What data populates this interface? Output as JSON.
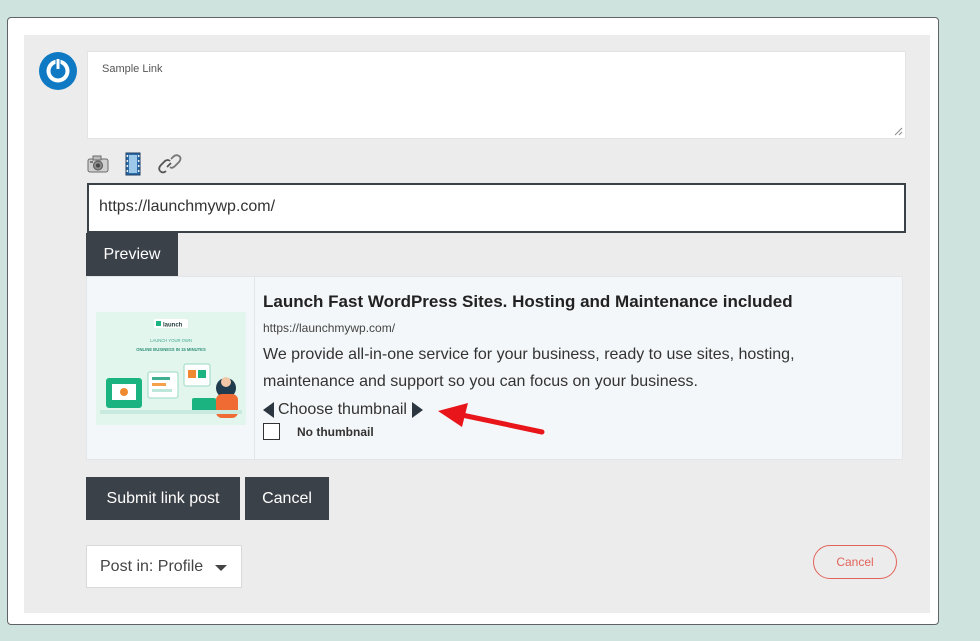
{
  "composer": {
    "placeholder": "Sample Link"
  },
  "attachments": {
    "icons": [
      "camera-icon",
      "film-icon",
      "link-icon"
    ]
  },
  "link_input": {
    "value": "https://launchmywp.com/"
  },
  "preview_button": "Preview",
  "link_preview": {
    "title": "Launch Fast WordPress Sites. Hosting and Maintenance included",
    "url": "https://launchmywp.com/",
    "description": "We provide all-in-one service for your business, ready to use sites, hosting, maintenance and support so you can focus on your business.",
    "choose_thumbnail": "Choose thumbnail",
    "no_thumbnail": "No thumbnail",
    "thumbnail_image": {
      "logo": "launch",
      "line1": "LAUNCH YOUR OWN",
      "line2": "ONLINE BUSINESS IN 15 MINUTES"
    }
  },
  "actions": {
    "submit": "Submit link post",
    "cancel": "Cancel"
  },
  "post_in": {
    "selected": "Post in: Profile"
  },
  "cancel_pill": "Cancel",
  "colors": {
    "page_bg": "#cfe3de",
    "dark_button": "#3b4148",
    "accent_blue": "#0f7ac3",
    "danger": "#e2635a",
    "annotation_arrow": "#e8151b"
  }
}
